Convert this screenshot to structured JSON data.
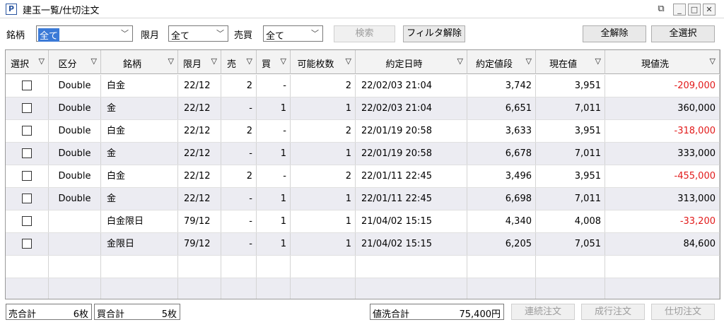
{
  "window": {
    "app_icon": "P",
    "title": "建玉一覧/仕切注文",
    "icons": [
      "restore-icon",
      "minimize-icon",
      "maximize-icon",
      "close-icon"
    ]
  },
  "filters": {
    "symbol_label": "銘柄",
    "symbol_value": "全て",
    "month_label": "限月",
    "month_value": "全て",
    "side_label": "売買",
    "side_value": "全て",
    "search_button": "検索",
    "clear_filter_button": "フィルタ解除",
    "deselect_all_button": "全解除",
    "select_all_button": "全選択"
  },
  "table": {
    "columns": [
      "選択",
      "区分",
      "銘柄",
      "限月",
      "売",
      "買",
      "可能枚数",
      "約定日時",
      "約定値段",
      "現在値",
      "現値洗"
    ],
    "rows": [
      {
        "category": "Double",
        "symbol": "白金",
        "month": "22/12",
        "sell": "2",
        "buy": "-",
        "qty": "2",
        "datetime": "22/02/03 21:04",
        "price": "3,742",
        "current": "3,951",
        "mtm": "-209,000",
        "negative": true
      },
      {
        "category": "Double",
        "symbol": "金",
        "month": "22/12",
        "sell": "-",
        "buy": "1",
        "qty": "1",
        "datetime": "22/02/03 21:04",
        "price": "6,651",
        "current": "7,011",
        "mtm": "360,000",
        "negative": false
      },
      {
        "category": "Double",
        "symbol": "白金",
        "month": "22/12",
        "sell": "2",
        "buy": "-",
        "qty": "2",
        "datetime": "22/01/19 20:58",
        "price": "3,633",
        "current": "3,951",
        "mtm": "-318,000",
        "negative": true
      },
      {
        "category": "Double",
        "symbol": "金",
        "month": "22/12",
        "sell": "-",
        "buy": "1",
        "qty": "1",
        "datetime": "22/01/19 20:58",
        "price": "6,678",
        "current": "7,011",
        "mtm": "333,000",
        "negative": false
      },
      {
        "category": "Double",
        "symbol": "白金",
        "month": "22/12",
        "sell": "2",
        "buy": "-",
        "qty": "2",
        "datetime": "22/01/11 22:45",
        "price": "3,496",
        "current": "3,951",
        "mtm": "-455,000",
        "negative": true
      },
      {
        "category": "Double",
        "symbol": "金",
        "month": "22/12",
        "sell": "-",
        "buy": "1",
        "qty": "1",
        "datetime": "22/01/11 22:45",
        "price": "6,698",
        "current": "7,011",
        "mtm": "313,000",
        "negative": false
      },
      {
        "category": "",
        "symbol": "白金限日",
        "month": "79/12",
        "sell": "-",
        "buy": "1",
        "qty": "1",
        "datetime": "21/04/02 15:15",
        "price": "4,340",
        "current": "4,008",
        "mtm": "-33,200",
        "negative": true
      },
      {
        "category": "",
        "symbol": "金限日",
        "month": "79/12",
        "sell": "-",
        "buy": "1",
        "qty": "1",
        "datetime": "21/04/02 15:15",
        "price": "6,205",
        "current": "7,051",
        "mtm": "84,600",
        "negative": false
      }
    ]
  },
  "footer": {
    "sell_total_label": "売合計",
    "sell_total_value": "6枚",
    "buy_total_label": "買合計",
    "buy_total_value": "5枚",
    "mtm_total_label": "値洗合計",
    "mtm_total_value": "75,400円",
    "continuous_order_button": "連続注文",
    "market_order_button": "成行注文",
    "close_order_button": "仕切注文"
  },
  "colors": {
    "negative": "#e21a1a",
    "selection": "#3b7ad7",
    "alt_row": "#ececf2"
  }
}
